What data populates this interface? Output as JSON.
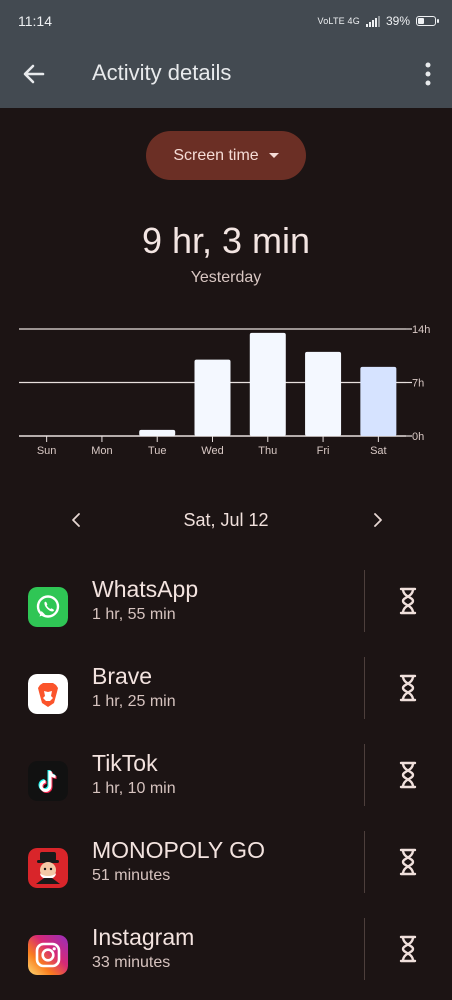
{
  "status": {
    "time": "11:14",
    "network": "VoLTE 4G",
    "battery": "39%",
    "battery_level": 0.39
  },
  "header": {
    "title": "Activity details"
  },
  "metric_selector": {
    "label": "Screen time"
  },
  "summary": {
    "total": "9 hr, 3 min",
    "period": "Yesterday"
  },
  "chart_data": {
    "type": "bar",
    "categories": [
      "Sun",
      "Mon",
      "Tue",
      "Wed",
      "Thu",
      "Fri",
      "Sat"
    ],
    "values": [
      0,
      0,
      0.8,
      10,
      13.5,
      11,
      9.05
    ],
    "unit": "hours",
    "ylim": [
      0,
      14
    ],
    "yticks": [
      "0h",
      "7h",
      "14h"
    ],
    "selected": "Sat",
    "colors": {
      "bar": "#f4f8ff",
      "selected_bar": "#d6e3ff",
      "grid": "#e8e0de"
    }
  },
  "date_nav": {
    "label": "Sat, Jul 12"
  },
  "apps": [
    {
      "name": "WhatsApp",
      "usage": "1 hr, 55 min",
      "icon": "whatsapp-icon"
    },
    {
      "name": "Brave",
      "usage": "1 hr, 25 min",
      "icon": "brave-icon"
    },
    {
      "name": "TikTok",
      "usage": "1 hr, 10 min",
      "icon": "tiktok-icon"
    },
    {
      "name": "MONOPOLY GO",
      "usage": "51 minutes",
      "icon": "monopoly-go-icon"
    },
    {
      "name": "Instagram",
      "usage": "33 minutes",
      "icon": "instagram-icon"
    }
  ]
}
